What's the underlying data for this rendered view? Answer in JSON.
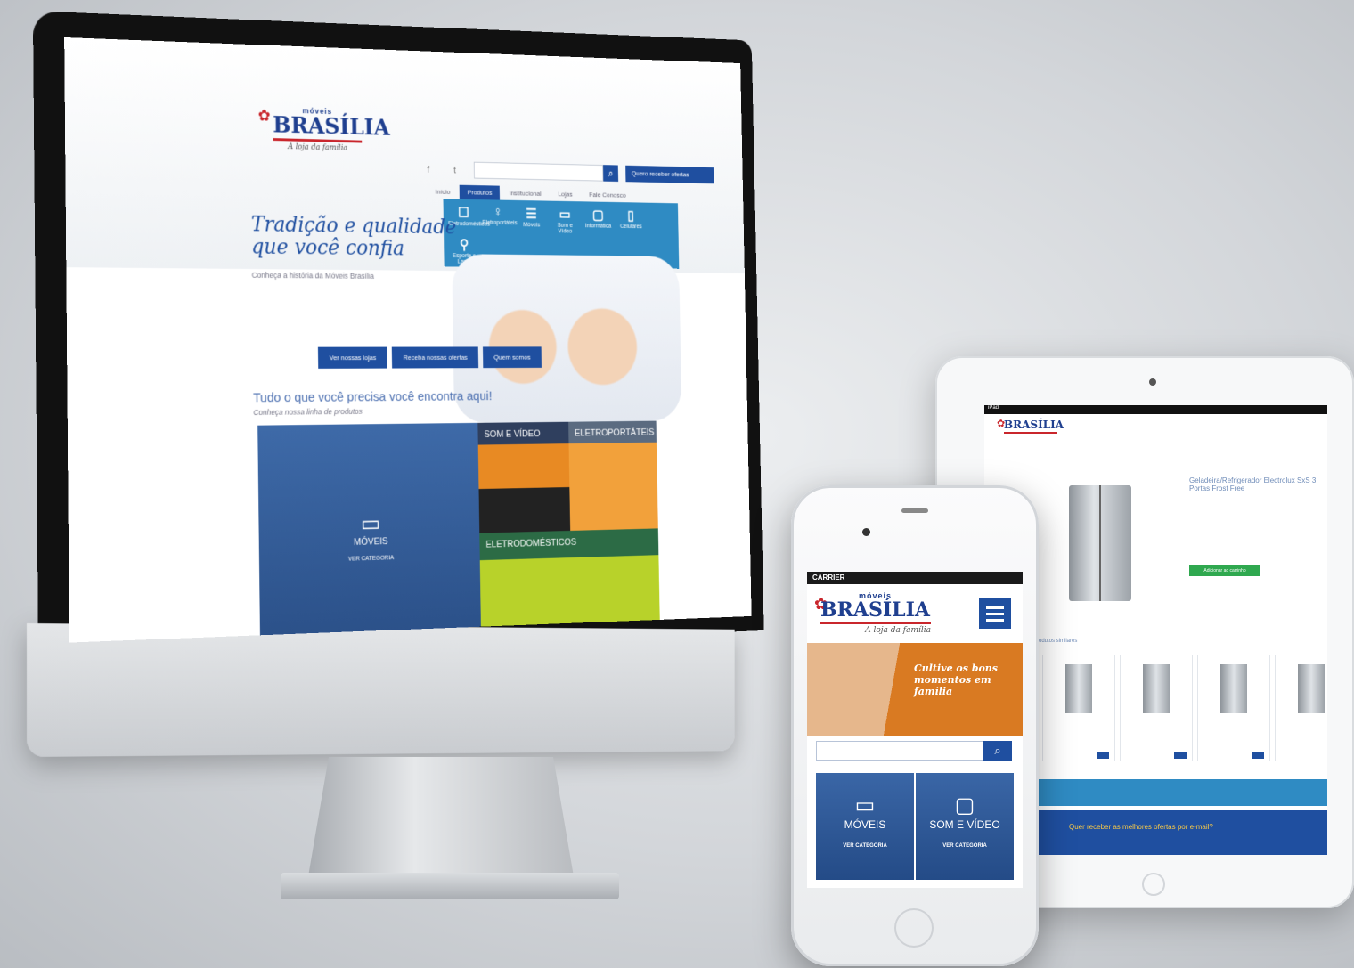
{
  "desktop": {
    "logo": {
      "small": "móveis",
      "brand": "BRASÍLIA",
      "tagline": "A loja da família"
    },
    "social": "f t g",
    "cta": "Quero receber ofertas",
    "nav": [
      "Início",
      "Produtos",
      "Institucional",
      "Lojas",
      "Fale Conosco"
    ],
    "mega_menu": [
      {
        "icon": "☐",
        "label": "Eletrodomésticos"
      },
      {
        "icon": "♀",
        "label": "Eletroportáteis"
      },
      {
        "icon": "☰",
        "label": "Móveis"
      },
      {
        "icon": "▭",
        "label": "Som e Vídeo"
      },
      {
        "icon": "▢",
        "label": "Informática"
      },
      {
        "icon": "▯",
        "label": "Celulares"
      },
      {
        "icon": "⚲",
        "label": "Esporte e Lazer"
      }
    ],
    "hero": {
      "title_line1": "Tradição e qualidade",
      "title_line2": "que você confia",
      "subtitle": "Conheça a história da Móveis Brasília",
      "buttons": [
        "Ver nossas lojas",
        "Receba nossas ofertas",
        "Quem somos"
      ]
    },
    "section": {
      "title": "Tudo o que você precisa você encontra aqui!",
      "subtitle": "Conheça nossa linha de produtos"
    },
    "categories": {
      "moveis": {
        "label": "MÓVEIS",
        "link": "VER CATEGORIA"
      },
      "som_video": {
        "label": "SOM E VÍDEO"
      },
      "eletroportateis": {
        "label": "ELETROPORTÁTEIS"
      },
      "eletrodomesticos": {
        "label": "ELETRODOMÉSTICOS"
      }
    }
  },
  "tablet": {
    "status": "iPad",
    "product_title": "Geladeira/Refrigerador Electrolux SxS 3 Portas Frost Free",
    "buy_label": "Adicionar ao carrinho",
    "related_title": "Produtos similares",
    "newsletter": "Quer receber as melhores ofertas por e-mail?"
  },
  "phone": {
    "carrier": "CARRIER",
    "logo": {
      "small": "móveis",
      "brand": "BRASÍLIA",
      "tagline": "A loja da família"
    },
    "banner": "Cultive os bons momentos em família",
    "tiles": [
      {
        "icon": "▭",
        "label": "MÓVEIS",
        "link": "VER CATEGORIA"
      },
      {
        "icon": "▢",
        "label": "SOM E VÍDEO",
        "link": "VER CATEGORIA"
      }
    ]
  }
}
